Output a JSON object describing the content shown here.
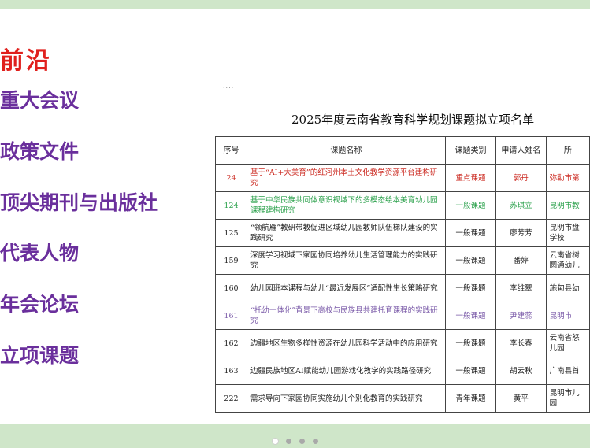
{
  "slide": {
    "heading": "前沿",
    "menu": [
      "重大会议",
      "政策文件",
      "顶尖期刊与出版社",
      "代表人物",
      "年会论坛",
      "立项课题"
    ],
    "doc_mark": "....",
    "doc_title": "2025年度云南省教育科学规划课题拟立项名单"
  },
  "table": {
    "headers": [
      "序号",
      "课题名称",
      "课题类别",
      "申请人姓名",
      "所"
    ],
    "rows": [
      {
        "no": "24",
        "name": "基于“AI+大美育”的红河州本土文化教学资源平台建构研究",
        "category": "重点课题",
        "applicant": "郭丹",
        "unit": "弥勒市第"
      },
      {
        "no": "124",
        "name": "基于中华民族共同体意识视域下的多模态绘本美育幼儿园课程建构研究",
        "category": "一般课题",
        "applicant": "苏琪立",
        "unit": "昆明市教"
      },
      {
        "no": "125",
        "name": "“领航雁”教研带教促进区域幼儿园教师队伍梯队建设的实践研究",
        "category": "一般课题",
        "applicant": "廖芳芳",
        "unit": "昆明市盘学校"
      },
      {
        "no": "159",
        "name": "深度学习视域下家园协同培养幼儿生活管理能力的实践研究",
        "category": "一般课题",
        "applicant": "番婷",
        "unit": "云南省树圆通幼儿"
      },
      {
        "no": "160",
        "name": "幼儿园班本课程与幼儿“最近发展区”适配性生长策略研究",
        "category": "一般课题",
        "applicant": "李维翠",
        "unit": "施甸县幼"
      },
      {
        "no": "161",
        "name": "“托幼一体化”背景下高校与民族县共建托育课程的实践研究",
        "category": "一般课题",
        "applicant": "尹建蕊",
        "unit": "昆明市"
      },
      {
        "no": "162",
        "name": "边疆地区生物多样性资源在幼儿园科学活动中的应用研究",
        "category": "一般课题",
        "applicant": "李长春",
        "unit": "云南省怒儿园"
      },
      {
        "no": "163",
        "name": "边疆民族地区AI赋能幼儿园游戏化教学的实践路径研究",
        "category": "一般课题",
        "applicant": "胡云秋",
        "unit": "广南县首"
      },
      {
        "no": "222",
        "name": "需求导向下家园协同实施幼儿个别化教育的实践研究",
        "category": "青年课题",
        "applicant": "黄平",
        "unit": "昆明市儿园"
      }
    ]
  },
  "row_colors": {
    "red": "#cc2b22",
    "green": "#29a04a",
    "purple": "#7a5aa8"
  },
  "pager": {
    "count": 4,
    "active": 0
  }
}
